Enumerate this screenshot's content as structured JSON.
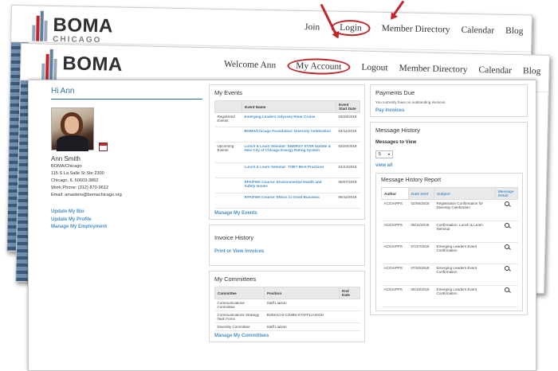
{
  "brand": {
    "name": "BOMA",
    "sub": "CHICAGO"
  },
  "header_back": {
    "nav": [
      "Join",
      "Login",
      "Member Directory",
      "Calendar",
      "Blog"
    ]
  },
  "header_front": {
    "nav": [
      "Welcome Ann",
      "My Account",
      "Logout",
      "Member Directory",
      "Calendar",
      "Blog"
    ]
  },
  "profile": {
    "greeting": "Hi Ann",
    "name": "Ann Smith",
    "org": "BOMA/Chicago",
    "address1": "115 S La Salle St Ste 2300",
    "address2": "Chicago, IL 60603-3862",
    "phone": "Work Phone: (312) 870-9612",
    "email": "Email: amasters@bomachicago.org",
    "links": [
      "Update My Bio",
      "Update My Profile",
      "Manage My Employment"
    ]
  },
  "events": {
    "title": "My Events",
    "headers": [
      "",
      "Event Name",
      "Event Start Date"
    ],
    "rows": [
      {
        "group": "Registered Events",
        "name": "Emerging Leaders Odyssey River Cruise",
        "date": "03/28/2019"
      },
      {
        "group": "",
        "name": "BOMA/Chicago Foundation: Diversity Celebration",
        "date": "04/11/2019"
      },
      {
        "group": "Upcoming Events",
        "name": "Lunch & Learn Seminar: ENERGY STAR Update & New City of Chicago Energy Rating System",
        "date": "03/20/2019"
      },
      {
        "group": "",
        "name": "Lunch & Learn Seminar: TOBY Best Practices",
        "date": "04/24/2019"
      },
      {
        "group": "",
        "name": "RPA/FMA Course: Environmental Health and Safety Issues",
        "date": "05/07/2019"
      },
      {
        "group": "",
        "name": "RPA/FMA Course: Ethics in Good Business",
        "date": "06/11/2019"
      }
    ],
    "link": "Manage My Events"
  },
  "invoice": {
    "title": "Invoice History",
    "link": "Print or View Invoices"
  },
  "committees": {
    "title": "My Committees",
    "headers": [
      "Committee",
      "Position",
      "End Date"
    ],
    "rows": [
      {
        "committee": "Communications Committee",
        "position": "Staff Liaison",
        "end": ""
      },
      {
        "committee": "Communications Strategy Task Force",
        "position": "BOMACHI-COMM-STAFFLIAISON",
        "end": ""
      },
      {
        "committee": "Diversity Committee",
        "position": "Staff Liaison",
        "end": ""
      }
    ],
    "link": "Manage My Committees"
  },
  "payments": {
    "title": "Payments Due",
    "note": "You currently have no outstanding invoices.",
    "link": "Pay Invoices"
  },
  "messages": {
    "title": "Message History",
    "label": "Messages to View",
    "select_value": "5",
    "view_all": "view all",
    "report_title": "Message History Report",
    "headers": [
      "Author",
      "Date Sent",
      "Subject",
      "Message Detail"
    ],
    "rows": [
      {
        "author": "ACGIAPPS",
        "date": "02/06/2019",
        "subject": "Registration Confirmation for Diversity Celebration"
      },
      {
        "author": "ACGIAPPS",
        "date": "09/11/2018",
        "subject": "Confirmation: Lunch & Learn Seminar"
      },
      {
        "author": "ACGIAPPS",
        "date": "07/27/2018",
        "subject": "Emerging Leaders Event Confirmation"
      },
      {
        "author": "ACGIAPPS",
        "date": "07/20/2018",
        "subject": "Emerging Leaders Event Confirmation"
      },
      {
        "author": "ACGIAPPS",
        "date": "05/10/2018",
        "subject": "Emerging Leaders Event Confirmation"
      }
    ]
  },
  "colors": {
    "accent": "#c12429",
    "link": "#4a90c7",
    "brand_text": "#2d2f33"
  }
}
